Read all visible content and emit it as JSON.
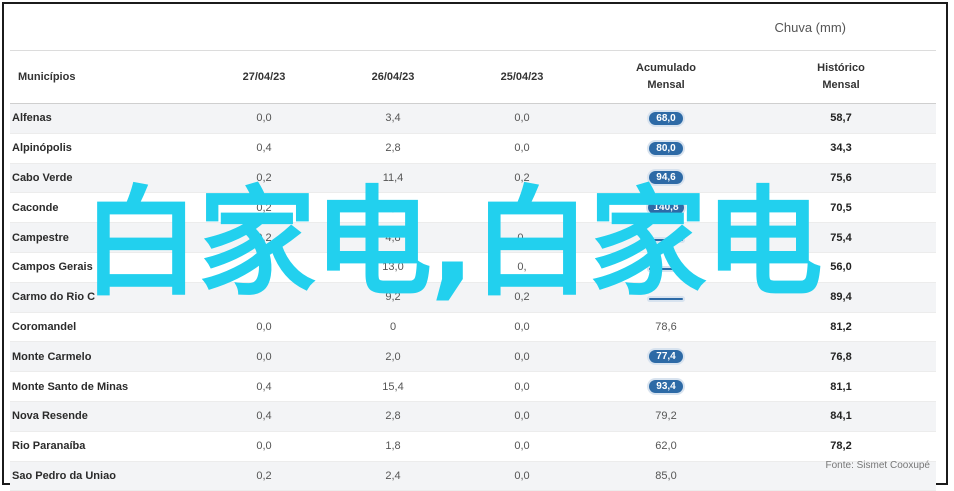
{
  "header": {
    "chuva_label": "Chuva (mm)"
  },
  "columns": [
    "Municípios",
    "27/04/23",
    "26/04/23",
    "25/04/23",
    "Acumulado Mensal",
    "Histórico Mensal"
  ],
  "rows": [
    {
      "name": "Alfenas",
      "d1": "0,0",
      "d2": "3,4",
      "d3": "0,0",
      "acum": "68,0",
      "hist": "58,7",
      "acum_pill": true
    },
    {
      "name": "Alpinópolis",
      "d1": "0,4",
      "d2": "2,8",
      "d3": "0,0",
      "acum": "80,0",
      "hist": "34,3",
      "acum_pill": true
    },
    {
      "name": "Cabo Verde",
      "d1": "0,2",
      "d2": "11,4",
      "d3": "0,2",
      "acum": "94,6",
      "hist": "75,6",
      "acum_pill": true
    },
    {
      "name": "Caconde",
      "d1": "0,2",
      "d2": "7,6",
      "d3": "0,0",
      "acum": "140,8",
      "hist": "70,5",
      "acum_pill": true
    },
    {
      "name": "Campestre",
      "d1": "0,2",
      "d2": "4,8",
      "d3": "0,",
      "acum": "",
      "hist": "75,4",
      "acum_pill": true
    },
    {
      "name": "Campos Gerais",
      "d1": "",
      "d2": "13,0",
      "d3": "0,",
      "acum": "",
      "hist": "56,0",
      "acum_pill": true
    },
    {
      "name": "Carmo do Rio C",
      "d1": "",
      "d2": "9,2",
      "d3": "0,2",
      "acum": "",
      "hist": "89,4",
      "acum_pill": true
    },
    {
      "name": "Coromandel",
      "d1": "0,0",
      "d2": "0",
      "d3": "0,0",
      "acum": "78,6",
      "hist": "81,2",
      "acum_pill": false
    },
    {
      "name": "Monte Carmelo",
      "d1": "0,0",
      "d2": "2,0",
      "d3": "0,0",
      "acum": "77,4",
      "hist": "76,8",
      "acum_pill": true
    },
    {
      "name": "Monte Santo de Minas",
      "d1": "0,4",
      "d2": "15,4",
      "d3": "0,0",
      "acum": "93,4",
      "hist": "81,1",
      "acum_pill": true
    },
    {
      "name": "Nova Resende",
      "d1": "0,4",
      "d2": "2,8",
      "d3": "0,0",
      "acum": "79,2",
      "hist": "84,1",
      "acum_pill": false
    },
    {
      "name": "Rio Paranaíba",
      "d1": "0,0",
      "d2": "1,8",
      "d3": "0,0",
      "acum": "62,0",
      "hist": "78,2",
      "acum_pill": false
    },
    {
      "name": "Sao Pedro da Uniao",
      "d1": "0,2",
      "d2": "2,4",
      "d3": "0,0",
      "acum": "85,0",
      "hist": "",
      "acum_pill": false
    }
  ],
  "footer": {
    "source": "Fonte: Sismet Cooxupé"
  },
  "overlay": {
    "watermark": "白家电,白家电"
  },
  "colors": {
    "pill": "#2d6aa6",
    "watermark": "#22d0ee"
  }
}
